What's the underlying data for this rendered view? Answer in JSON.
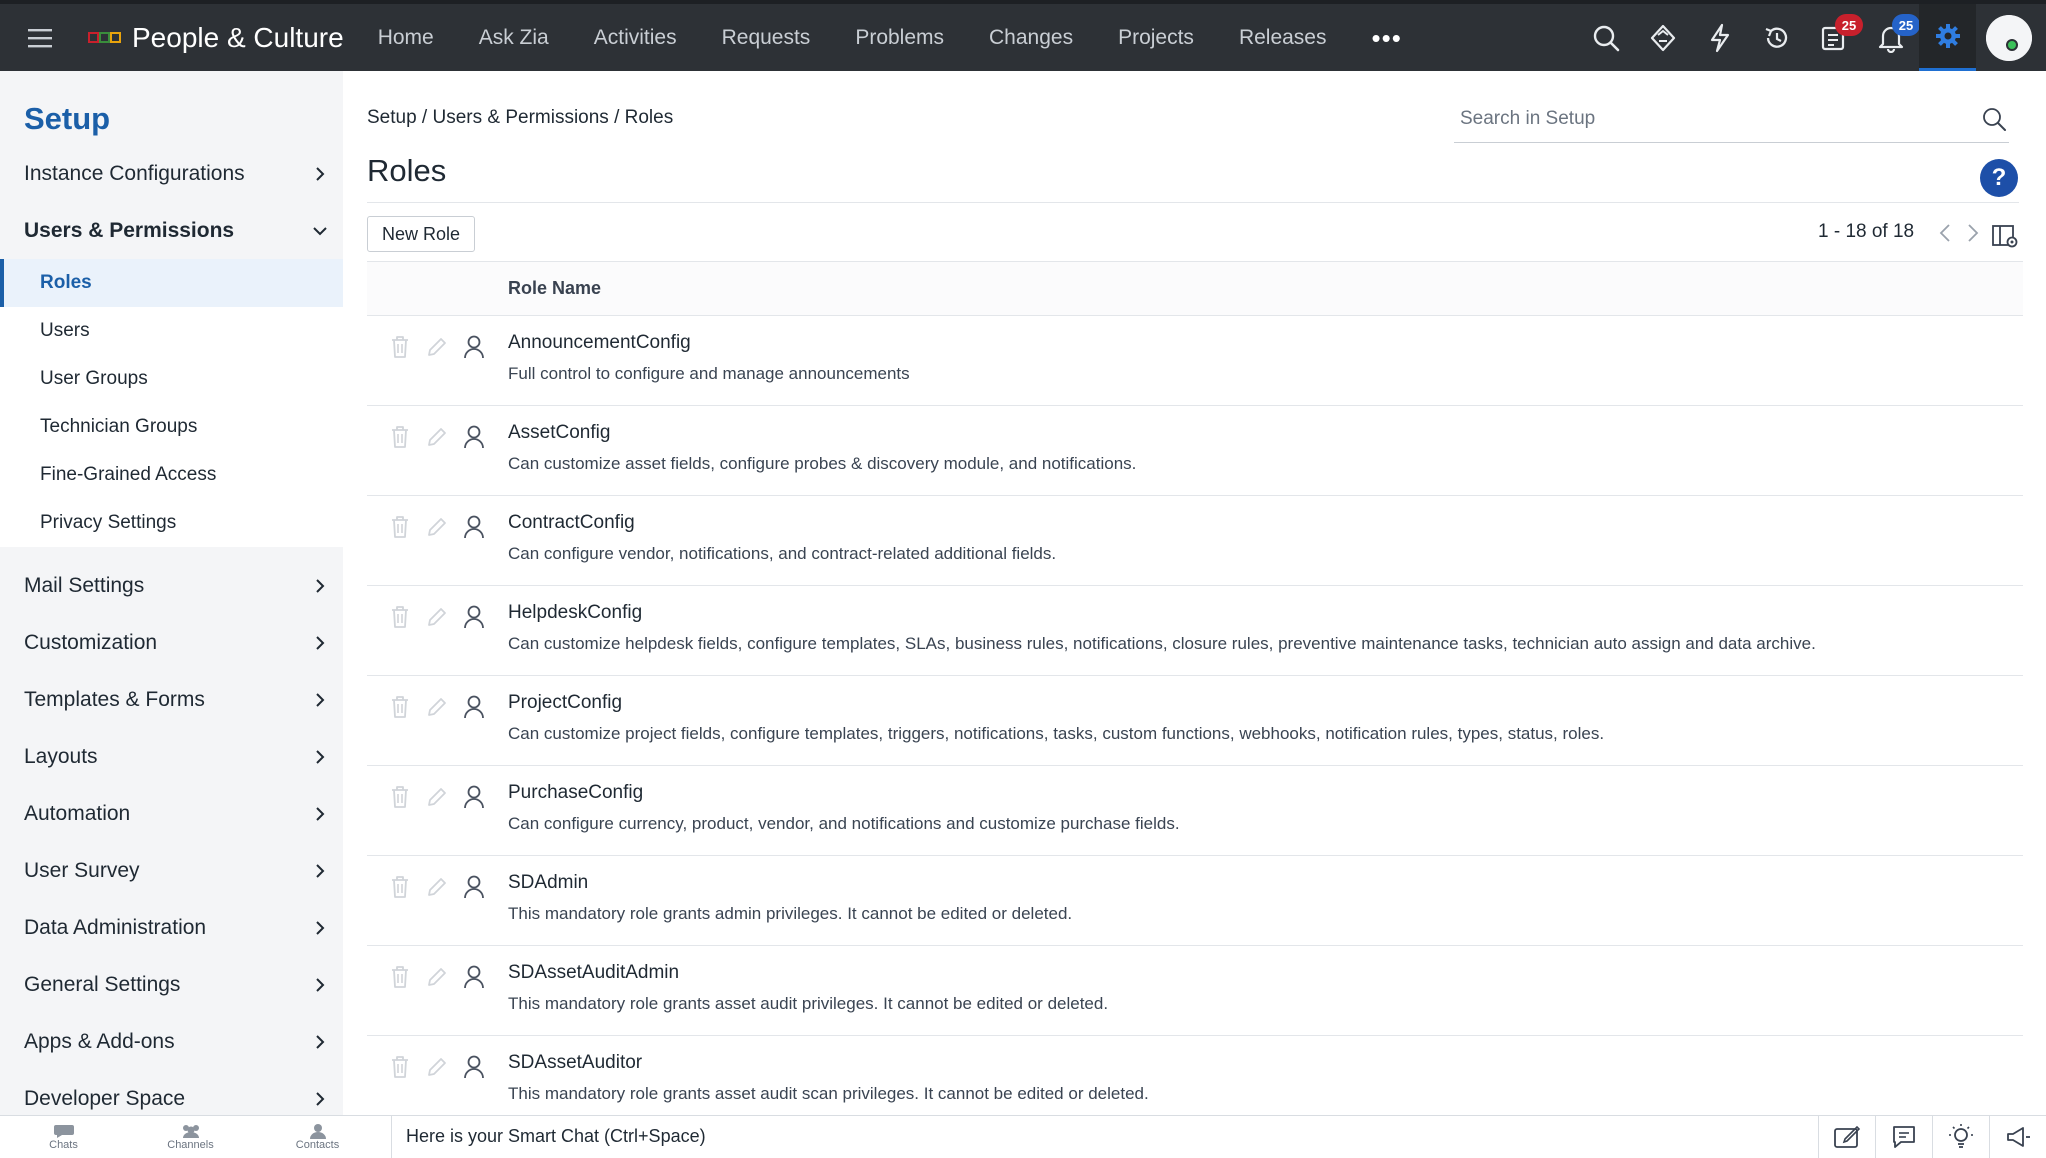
{
  "header": {
    "app_name": "People & Culture",
    "nav": [
      "Home",
      "Ask Zia",
      "Activities",
      "Requests",
      "Problems",
      "Changes",
      "Projects",
      "Releases"
    ],
    "more": "•••",
    "badges": {
      "tasks": "25",
      "notifications": "25"
    },
    "icons": [
      "search-icon",
      "zia-icon",
      "quick-actions-icon",
      "history-icon",
      "tasks-icon",
      "notifications-icon",
      "settings-icon"
    ]
  },
  "sidebar": {
    "title": "Setup",
    "instance_config": "Instance Configurations",
    "users_permissions": "Users & Permissions",
    "sub_items": [
      "Roles",
      "Users",
      "User Groups",
      "Technician Groups",
      "Fine-Grained Access",
      "Privacy Settings"
    ],
    "sections": [
      "Mail Settings",
      "Customization",
      "Templates & Forms",
      "Layouts",
      "Automation",
      "User Survey",
      "Data Administration",
      "General Settings",
      "Apps & Add-ons",
      "Developer Space"
    ]
  },
  "main": {
    "breadcrumb": "Setup / Users & Permissions / Roles",
    "search_placeholder": "Search in Setup",
    "title": "Roles",
    "help": "?",
    "new_role": "New Role",
    "pager": "1 - 18 of 18",
    "column_header": "Role Name",
    "roles": [
      {
        "name": "AnnouncementConfig",
        "desc": "Full control to configure and manage announcements"
      },
      {
        "name": "AssetConfig",
        "desc": "Can customize asset fields, configure probes & discovery module, and notifications."
      },
      {
        "name": "ContractConfig",
        "desc": "Can configure vendor, notifications, and contract-related additional fields."
      },
      {
        "name": "HelpdeskConfig",
        "desc": "Can customize helpdesk fields, configure templates, SLAs, business rules, notifications, closure rules, preventive maintenance tasks, technician auto assign and data archive."
      },
      {
        "name": "ProjectConfig",
        "desc": "Can customize project fields, configure templates, triggers, notifications, tasks, custom functions, webhooks, notification rules, types, status, roles."
      },
      {
        "name": "PurchaseConfig",
        "desc": "Can configure currency, product, vendor, and notifications and customize purchase fields."
      },
      {
        "name": "SDAdmin",
        "desc": "This mandatory role grants admin privileges. It cannot be edited or deleted."
      },
      {
        "name": "SDAssetAuditAdmin",
        "desc": "This mandatory role grants asset audit privileges. It cannot be edited or deleted."
      },
      {
        "name": "SDAssetAuditor",
        "desc": "This mandatory role grants asset audit scan privileges. It cannot be edited or deleted."
      }
    ]
  },
  "bottom": {
    "tabs": [
      "Chats",
      "Channels",
      "Contacts"
    ],
    "smart_chat": "Here is your Smart Chat (Ctrl+Space)"
  }
}
